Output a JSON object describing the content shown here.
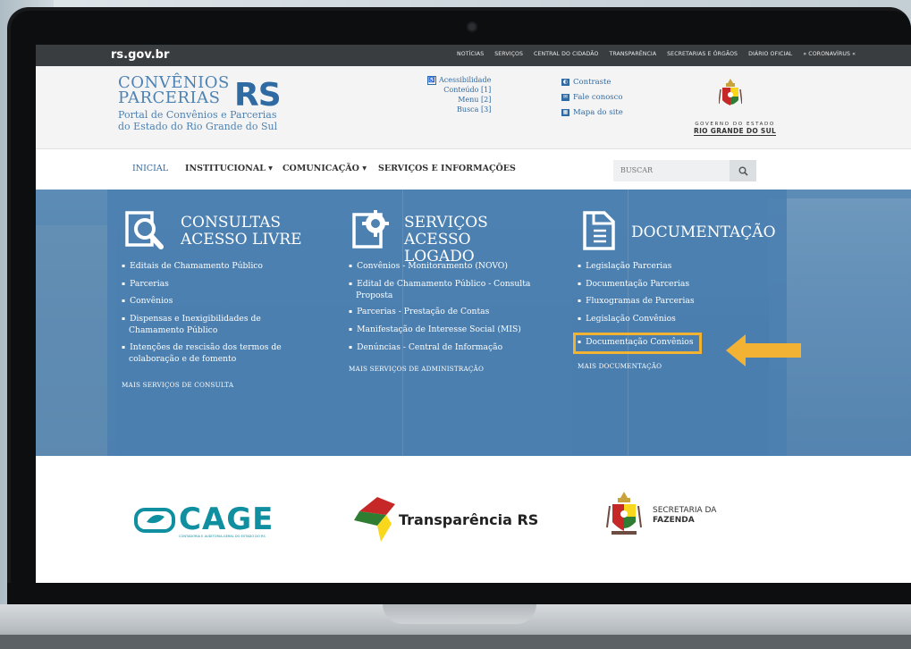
{
  "gov_bar": {
    "brand": "rs.gov.br",
    "links": [
      "NOTÍCIAS",
      "SERVIÇOS",
      "CENTRAL DO CIDADÃO",
      "TRANSPARÊNCIA",
      "SECRETARIAS E ÓRGÃOS",
      "DIÁRIO OFICIAL",
      "» CORONAVÍRUS «"
    ]
  },
  "header": {
    "logo_line1": "CONVÊNIOS",
    "logo_line2": "PARCERIAS",
    "logo_rs": "RS",
    "logo_sub1": "Portal de Convênios e Parcerias",
    "logo_sub2": "do Estado do Rio Grande do Sul",
    "accessibility": {
      "title": "Acessibilidade",
      "items": [
        "Conteúdo [1]",
        "Menu [2]",
        "Busca [3]"
      ]
    },
    "utility_links": [
      "Contraste",
      "Fale conosco",
      "Mapa do site"
    ],
    "gov_label_top": "GOVERNO DO ESTADO",
    "gov_label_bottom": "RIO GRANDE DO SUL"
  },
  "nav": {
    "items": [
      "INICIAL",
      "INSTITUCIONAL ▾",
      "COMUNICAÇÃO ▾",
      "SERVIÇOS E INFORMAÇÕES"
    ],
    "search_placeholder": "BUSCAR"
  },
  "columns": [
    {
      "title_line1": "CONSULTAS",
      "title_line2": "ACESSO LIVRE",
      "items": [
        "Editais de Chamamento Público",
        "Parcerias",
        "Convênios",
        "Dispensas e Inexigibilidades de Chamamento Público",
        "Intenções de rescisão dos termos de colaboração e de fomento"
      ],
      "more": "MAIS SERVIÇOS DE CONSULTA"
    },
    {
      "title_line1": "SERVIÇOS",
      "title_line2": "ACESSO LOGADO",
      "items": [
        "Convênios - Monitoramento (NOVO)",
        "Edital de Chamamento Público - Consulta Proposta",
        "Parcerias - Prestação de Contas",
        "Manifestação de Interesse Social (MIS)",
        "Denúncias - Central de Informação"
      ],
      "more": "MAIS SERVIÇOS DE ADMINISTRAÇÃO"
    },
    {
      "title_line1": "DOCUMENTAÇÃO",
      "items": [
        "Legislação Parcerias",
        "Documentação Parcerias",
        "Fluxogramas de Parcerias",
        "Legislação Convênios",
        "Documentação Convênios"
      ],
      "more": "MAIS DOCUMENTAÇÃO"
    }
  ],
  "partner_logos": {
    "cage": "CAGE",
    "cage_tagline": "CONTADORIA E AUDITORIA-GERAL DO ESTADO DO RS",
    "transparencia": "Transparência RS",
    "sefaz_line1": "SECRETARIA DA",
    "sefaz_line2": "FAZENDA"
  },
  "colors": {
    "hero_blue": "#4f82b0",
    "brand_blue": "#2f6aa3",
    "highlight": "#f2b233"
  }
}
